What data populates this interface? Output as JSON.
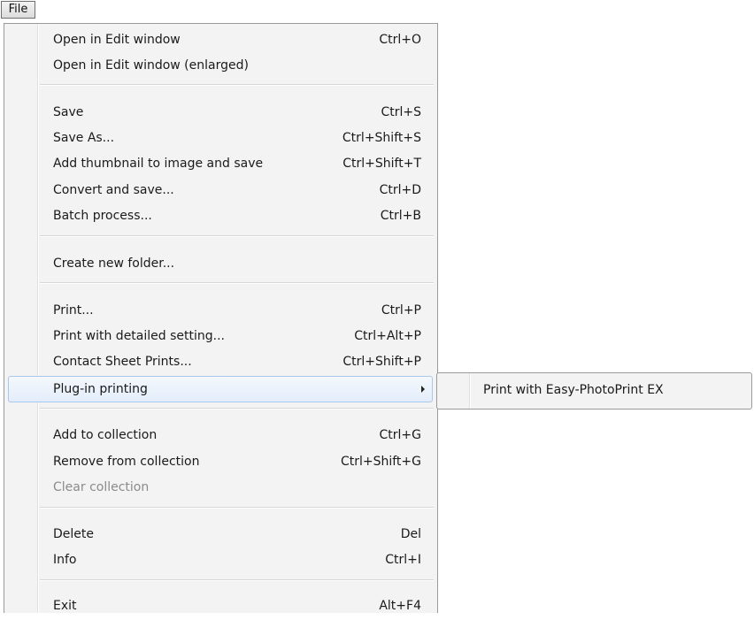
{
  "menubar": {
    "title": "File"
  },
  "menu": {
    "items": [
      {
        "label": "Open in Edit window",
        "shortcut": "Ctrl+O"
      },
      {
        "label": "Open in Edit window (enlarged)",
        "shortcut": ""
      },
      {
        "label": "Save",
        "shortcut": "Ctrl+S"
      },
      {
        "label": "Save As...",
        "shortcut": "Ctrl+Shift+S"
      },
      {
        "label": "Add thumbnail to image and save",
        "shortcut": "Ctrl+Shift+T"
      },
      {
        "label": "Convert and save...",
        "shortcut": "Ctrl+D"
      },
      {
        "label": "Batch process...",
        "shortcut": "Ctrl+B"
      },
      {
        "label": "Create new folder...",
        "shortcut": ""
      },
      {
        "label": "Print...",
        "shortcut": "Ctrl+P"
      },
      {
        "label": "Print with detailed setting...",
        "shortcut": "Ctrl+Alt+P"
      },
      {
        "label": "Contact Sheet Prints...",
        "shortcut": "Ctrl+Shift+P"
      },
      {
        "label": "Plug-in printing",
        "shortcut": ""
      },
      {
        "label": "Add to collection",
        "shortcut": "Ctrl+G"
      },
      {
        "label": "Remove from collection",
        "shortcut": "Ctrl+Shift+G"
      },
      {
        "label": "Clear collection",
        "shortcut": ""
      },
      {
        "label": "Delete",
        "shortcut": "Del"
      },
      {
        "label": "Info",
        "shortcut": "Ctrl+I"
      },
      {
        "label": "Exit",
        "shortcut": "Alt+F4"
      }
    ]
  },
  "submenu": {
    "items": [
      {
        "label": "Print with Easy-PhotoPrint EX"
      }
    ]
  },
  "colors": {
    "menu_background": "#f3f3f3",
    "highlight_border": "#a8c7ec",
    "disabled_text": "#8b8b8b"
  },
  "icons": {
    "submenu_arrow": "triangle-right"
  }
}
